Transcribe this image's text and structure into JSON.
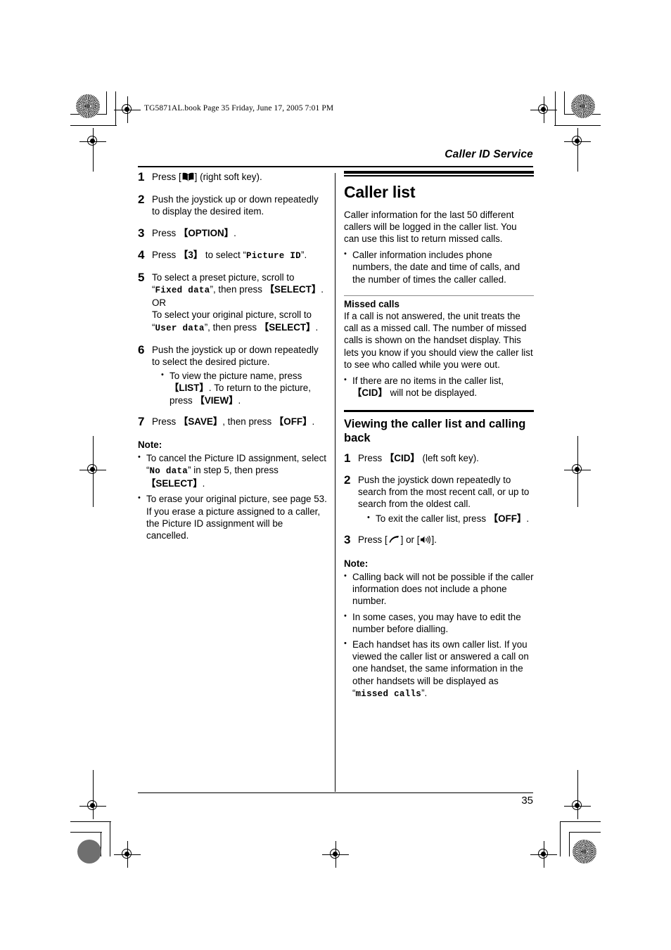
{
  "header": {
    "filestamp": "TG5871AL.book  Page 35  Friday, June 17, 2005  7:01 PM",
    "running_head": "Caller ID Service"
  },
  "footer": {
    "page_number": "35"
  },
  "left_column": {
    "steps": [
      {
        "num": "1",
        "pre": "Press [",
        "icon": "phonebook-icon",
        "post": "] (right soft key)."
      },
      {
        "num": "2",
        "text": "Push the joystick up or down repeatedly to display the desired item."
      },
      {
        "num": "3",
        "text_a": "Press ",
        "key": "{OPTION}",
        "text_b": "."
      },
      {
        "num": "4",
        "text_a": "Press ",
        "key": "{3}",
        "text_b": " to select “",
        "mono": "Picture ID",
        "text_c": "”."
      },
      {
        "num": "5",
        "line1": "To select a preset picture, scroll to",
        "quote1_open": "“",
        "mono1": "Fixed data",
        "quote1_close": "”, then press ",
        "key1": "{SELECT}",
        "period1": ".",
        "or": "OR",
        "line2": "To select your original picture, scroll to",
        "quote2_open": "“",
        "mono2": "User data",
        "quote2_close": "”, then press ",
        "key2": "{SELECT}",
        "period2": "."
      },
      {
        "num": "6",
        "text": "Push the joystick up or down repeatedly to select the desired picture.",
        "sub_bullet": {
          "a": "To view the picture name, press ",
          "key1": "{LIST}",
          "b": ". To return to the picture, press ",
          "key2": "{VIEW}",
          "c": "."
        }
      },
      {
        "num": "7",
        "text_a": "Press ",
        "key1": "{SAVE}",
        "text_b": ", then press ",
        "key2": "{OFF}",
        "text_c": "."
      }
    ],
    "note_label": "Note:",
    "notes": [
      {
        "a": "To cancel the Picture ID assignment, select “",
        "mono": "No data",
        "b": "” in step 5, then press ",
        "key": "{SELECT}",
        "c": "."
      },
      {
        "a": "To erase your original picture, see page 53. If you erase a picture assigned to a caller, the Picture ID assignment will be cancelled."
      }
    ]
  },
  "right_column": {
    "section_title": "Caller list",
    "intro": "Caller information for the last 50 different callers will be logged in the caller list. You can use this list to return missed calls.",
    "intro_bullets": [
      "Caller information includes phone numbers, the date and time of calls, and the number of times the caller called."
    ],
    "missed_calls": {
      "title": "Missed calls",
      "body": "If a call is not answered, the unit treats the call as a missed call. The number of missed calls is shown on the handset display. This lets you know if you should view the caller list to see who called while you were out.",
      "bullet": {
        "a": "If there are no items in the caller list, ",
        "key": "{CID}",
        "b": " will not be displayed."
      }
    },
    "viewing": {
      "title": "Viewing the caller list and calling back",
      "steps": [
        {
          "num": "1",
          "text_a": "Press ",
          "key": "{CID}",
          "text_b": " (left soft key)."
        },
        {
          "num": "2",
          "text": "Push the joystick down repeatedly to search from the most recent call, or up to search from the oldest call.",
          "sub_bullet": {
            "a": "To exit the caller list, press ",
            "key": "{OFF}",
            "b": "."
          }
        },
        {
          "num": "3",
          "text_a": "Press [",
          "icon1": "handset-talk-icon",
          "text_b": "] or [",
          "icon2": "speakerphone-icon",
          "text_c": "]."
        }
      ],
      "note_label": "Note:",
      "notes": [
        {
          "a": "Calling back will not be possible if the caller information does not include a phone number."
        },
        {
          "a": "In some cases, you may have to edit the number before dialling."
        },
        {
          "a": "Each handset has its own caller list. If you viewed the caller list or answered a call on one handset, the same information in the other handsets will be displayed as “",
          "mono": "missed calls",
          "b": "”."
        }
      ]
    }
  }
}
